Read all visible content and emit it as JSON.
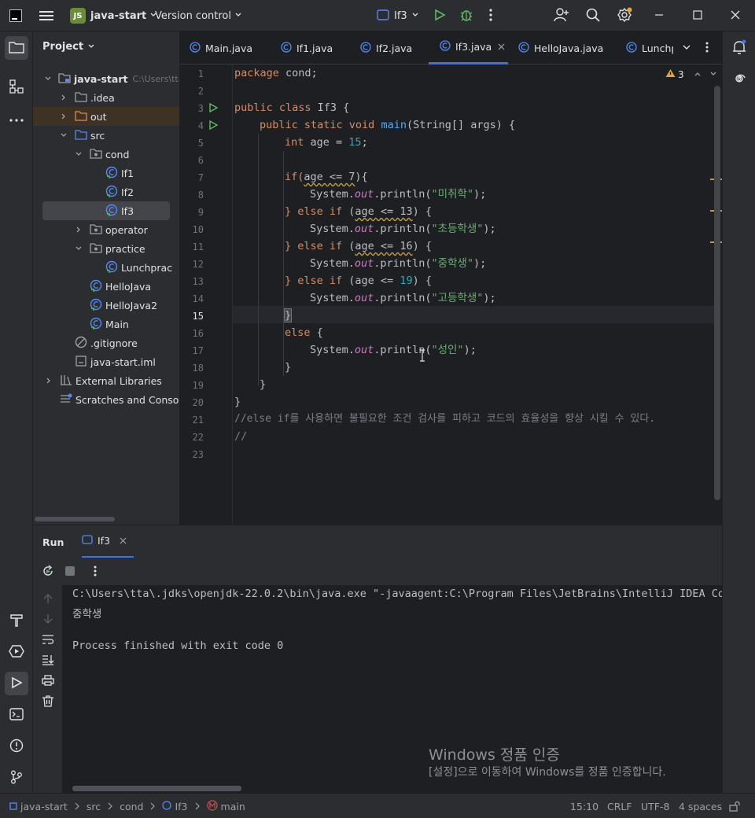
{
  "titlebar": {
    "project_badge": "JS",
    "project_name": "java-start",
    "vcs": "Version control",
    "run_config": "If3"
  },
  "project": {
    "title": "Project",
    "root_name": "java-start",
    "root_path": "C:\\Users\\tta",
    "items": [
      {
        "label": "java-start"
      },
      {
        "label": ".idea"
      },
      {
        "label": "out"
      },
      {
        "label": "src"
      },
      {
        "label": "cond"
      },
      {
        "label": "If1"
      },
      {
        "label": "If2"
      },
      {
        "label": "If3"
      },
      {
        "label": "operator"
      },
      {
        "label": "practice"
      },
      {
        "label": "Lunchprac"
      },
      {
        "label": "HelloJava"
      },
      {
        "label": "HelloJava2"
      },
      {
        "label": "Main"
      },
      {
        "label": ".gitignore"
      },
      {
        "label": "java-start.iml"
      },
      {
        "label": "External Libraries"
      },
      {
        "label": "Scratches and Consoles"
      }
    ]
  },
  "tabs": [
    {
      "label": "Main.java"
    },
    {
      "label": "If1.java"
    },
    {
      "label": "If2.java"
    },
    {
      "label": "If3.java",
      "active": true
    },
    {
      "label": "HelloJava.java"
    },
    {
      "label": "Lunchp"
    }
  ],
  "editor": {
    "warnings": "3",
    "line_numbers": [
      "1",
      "2",
      "3",
      "4",
      "5",
      "6",
      "7",
      "8",
      "9",
      "10",
      "11",
      "12",
      "13",
      "14",
      "15",
      "16",
      "17",
      "18",
      "19",
      "20",
      "21",
      "22",
      "23"
    ],
    "code": {
      "l1_kw": "package",
      "l1_rest": " cond;",
      "l3_kw": "public class",
      "l3_rest": " If3 {",
      "l4_kw": "public static void",
      "l4_fn": "main",
      "l4_rest": "(String[] args) {",
      "l5_kw": "int",
      "l5_mid": " age = ",
      "l5_num": "15",
      "l5_end": ";",
      "l7_a": "if(",
      "l7_warn": "age <= 7",
      "l7_end": "){",
      "sys": "System.",
      "out": "out",
      "println": ".println(",
      "close": ");",
      "s8": "\"미취학\"",
      "s10": "\"초등학생\"",
      "s12": "\"중학생\"",
      "s14": "\"고등학생\"",
      "s17": "\"성인\"",
      "else_if": "} else if",
      "paren_open": " (",
      "w9": "age <= 13",
      "w11": "age <= 16",
      "l13_mid": "age <= ",
      "n19": "19",
      "brace_open": ") {",
      "l15": "}",
      "else": "else",
      "else_brace": " {",
      "l18": "}",
      "l19": "}",
      "l20": "}",
      "l21": "//else if를 사용하면 불필요한 조건 검사를 피하고 코드의 효율성을 향상 시킬 수 있다.",
      "l22": "//"
    }
  },
  "run": {
    "title": "Run",
    "tab": "If3",
    "lines": [
      "C:\\Users\\tta\\.jdks\\openjdk-22.0.2\\bin\\java.exe \"-javaagent:C:\\Program Files\\JetBrains\\IntelliJ IDEA Comm",
      "중학생",
      "",
      "Process finished with exit code 0"
    ]
  },
  "watermark": {
    "title": "Windows 정품 인증",
    "subtitle": "[설정]으로 이동하여 Windows를 정품 인증합니다."
  },
  "status": {
    "breadcrumbs": [
      "java-start",
      "src",
      "cond",
      "If3",
      "main"
    ],
    "position": "15:10",
    "line_sep": "CRLF",
    "encoding": "UTF-8",
    "indent": "4 spaces"
  }
}
